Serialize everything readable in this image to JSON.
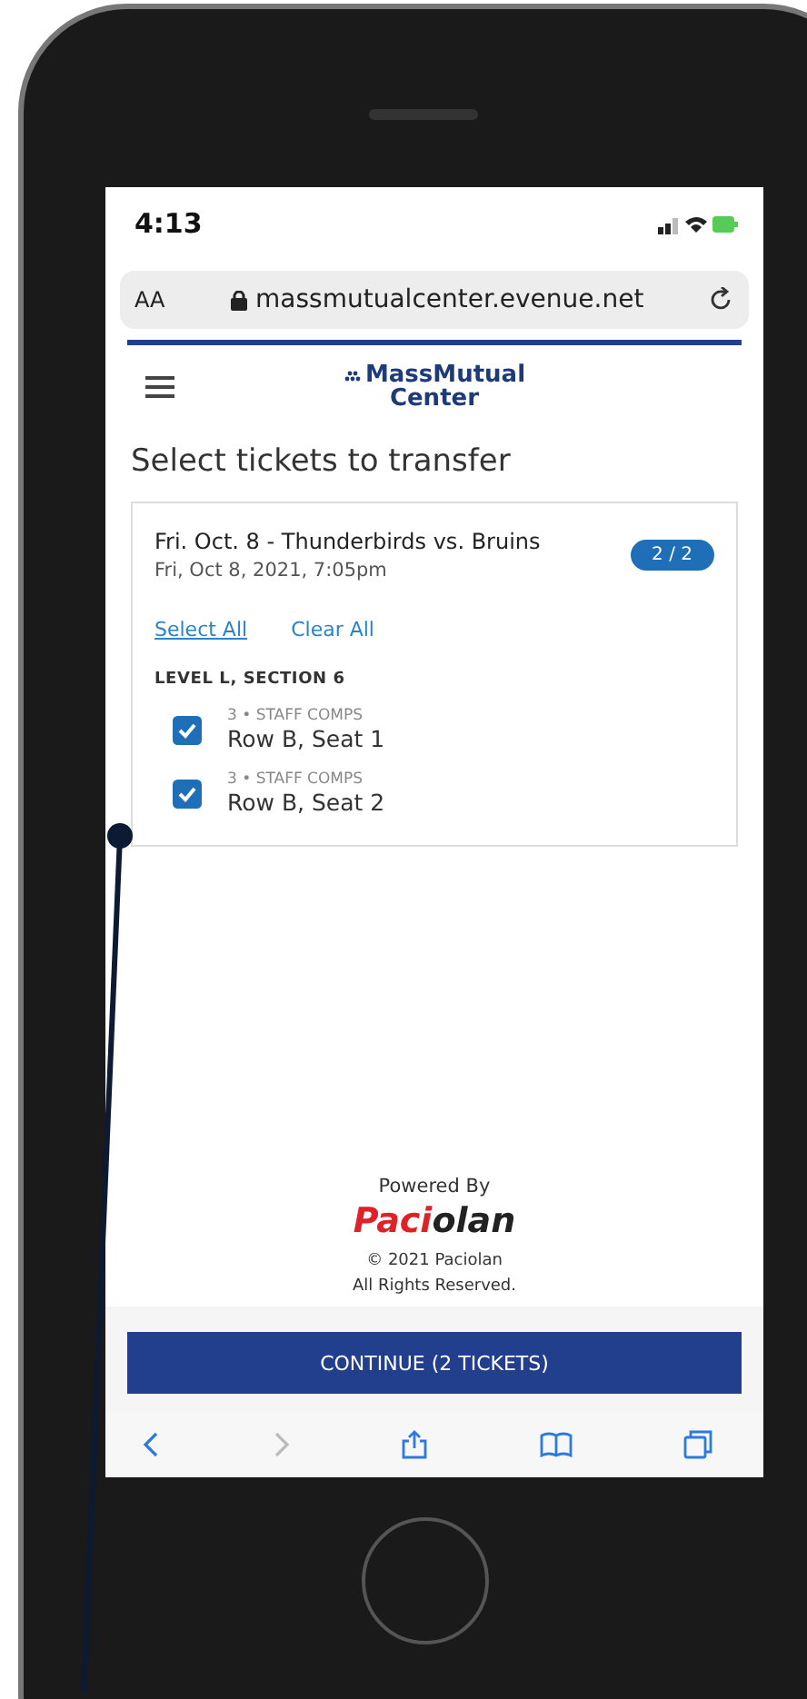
{
  "status_bar": {
    "time": "4:13"
  },
  "browser": {
    "text_size": "AA",
    "url": "massmutualcenter.evenue.net"
  },
  "header": {
    "logo_line_1": "MassMutual",
    "logo_line_2": "Center"
  },
  "page_title": "Select tickets to transfer",
  "event": {
    "title": "Fri. Oct. 8 - Thunderbirds vs. Bruins",
    "date": "Fri, Oct 8, 2021, 7:05pm",
    "count_badge": "2 / 2",
    "select_all": "Select All",
    "clear_all": "Clear All",
    "section": "LEVEL L, SECTION 6",
    "seats": [
      {
        "type": "3 • STAFF COMPS",
        "seat": "Row B, Seat 1",
        "checked": true
      },
      {
        "type": "3 • STAFF COMPS",
        "seat": "Row B, Seat 2",
        "checked": true
      }
    ]
  },
  "footer": {
    "powered_by": "Powered By",
    "brand_lead": "Paci",
    "brand_rest": "olan",
    "copyright": "© 2021 Paciolan",
    "rights": "All Rights Reserved."
  },
  "continue_button": "CONTINUE (2 TICKETS)"
}
